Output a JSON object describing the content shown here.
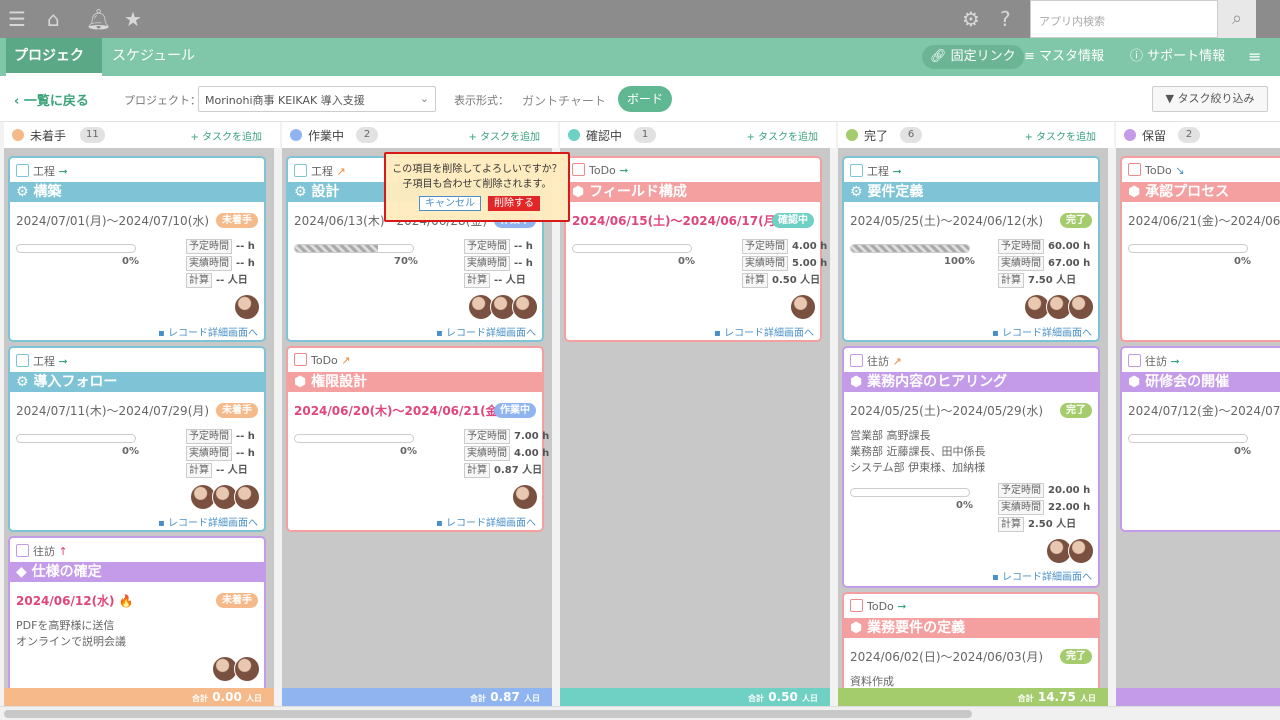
{
  "topbar": {
    "search_placeholder": "アプリ内検索"
  },
  "nav": {
    "tabs": [
      "プロジェクト",
      "スケジュール"
    ],
    "fixed_link": "固定リンク",
    "master": "マスタ情報",
    "support": "サポート情報"
  },
  "subbar": {
    "back": "一覧に戻る",
    "project_label": "プロジェクト：",
    "project_value": "Morinohi商事 KEIKAK 導入支援",
    "view_label": "表示形式：",
    "gantt": "ガントチャート",
    "board": "ボード",
    "filter": "タスク絞り込み"
  },
  "columns": [
    {
      "title": "未着手",
      "count": "11",
      "add": "+ タスクを追加",
      "color": "#f5b98a",
      "total_label": "合計",
      "total": "0.00",
      "unit": "人日"
    },
    {
      "title": "作業中",
      "count": "2",
      "add": "+ タスクを追加",
      "color": "#8fb4f0",
      "total_label": "合計",
      "total": "0.87",
      "unit": "人日"
    },
    {
      "title": "確認中",
      "count": "1",
      "add": "+ タスクを追加",
      "color": "#6fd0c4",
      "total_label": "合計",
      "total": "0.50",
      "unit": "人日"
    },
    {
      "title": "完了",
      "count": "6",
      "add": "+ タスクを追加",
      "color": "#a4cc6c",
      "total_label": "合計",
      "total": "14.75",
      "unit": "人日"
    },
    {
      "title": "保留",
      "count": "2",
      "add": "+ タスクを追加",
      "color": "#c49be8",
      "total_label": "合計",
      "total": "",
      "unit": ""
    }
  ],
  "labels": {
    "planned": "予定時間",
    "actual": "実績時間",
    "calc": "計算",
    "record": "レコード詳細画面へ"
  },
  "cards": {
    "c1": {
      "type": "工程",
      "title": "構築",
      "date": "2024/07/01(月)～2024/07/10(水)",
      "badge": "未着手",
      "pct": "0",
      "plan": "-- h",
      "act": "-- h",
      "calc": "-- 人日"
    },
    "c2": {
      "type": "工程",
      "title": "導入フォロー",
      "date": "2024/07/11(木)～2024/07/29(月)",
      "badge": "未着手",
      "pct": "0",
      "plan": "-- h",
      "act": "-- h",
      "calc": "-- 人日"
    },
    "c3": {
      "type": "往訪",
      "title": "仕様の確定",
      "date": "2024/06/12(水)",
      "badge": "未着手",
      "note1": "PDFを高野様に送信",
      "note2": "オンラインで説明会議"
    },
    "c4": {
      "type": "工程",
      "title": "設計",
      "date": "2024/06/13(木)～2024/06/28(金)",
      "badge": "作業中",
      "pct": "70",
      "progress": 0.7,
      "plan": "-- h",
      "act": "-- h",
      "calc": "-- 人日"
    },
    "c5": {
      "type": "ToDo",
      "title": "権限設計",
      "date": "2024/06/20(木)～2024/06/21(金)",
      "badge": "作業中",
      "pct": "0",
      "plan": "7.00 h",
      "act": "4.00 h",
      "calc": "0.87 人日"
    },
    "c6": {
      "type": "ToDo",
      "title": "フィールド構成",
      "date": "2024/06/15(土)～2024/06/17(月)",
      "badge": "確認中",
      "pct": "0",
      "plan": "4.00 h",
      "act": "5.00 h",
      "calc": "0.50 人日"
    },
    "c7": {
      "type": "工程",
      "title": "要件定義",
      "date": "2024/05/25(土)～2024/06/12(水)",
      "badge": "完了",
      "pct": "100",
      "progress": 1.0,
      "plan": "60.00 h",
      "act": "67.00 h",
      "calc": "7.50 人日"
    },
    "c8": {
      "type": "往訪",
      "title": "業務内容のヒアリング",
      "date": "2024/05/25(土)～2024/05/29(水)",
      "badge": "完了",
      "note1": "営業部 高野課長",
      "note2": "業務部 近藤課長、田中係長",
      "note3": "システム部 伊東様、加納様",
      "pct": "0",
      "plan": "20.00 h",
      "act": "22.00 h",
      "calc": "2.50 人日"
    },
    "c9": {
      "type": "ToDo",
      "title": "業務要件の定義",
      "date": "2024/06/02(日)～2024/06/03(月)",
      "badge": "完了",
      "note1": "資料作成"
    },
    "c10": {
      "type": "ToDo",
      "title": "承認プロセス",
      "date": "2024/06/21(金)～2024/06/22",
      "pct": "0"
    },
    "c11": {
      "type": "往訪",
      "title": "研修会の開催",
      "date": "2024/07/12(金)～2024/07/19",
      "pct": "0"
    }
  },
  "popup": {
    "msg1": "この項目を削除してよろしいですか？",
    "msg2": "子項目も合わせて削除されます。",
    "cancel": "キャンセル",
    "delete": "削除する"
  }
}
